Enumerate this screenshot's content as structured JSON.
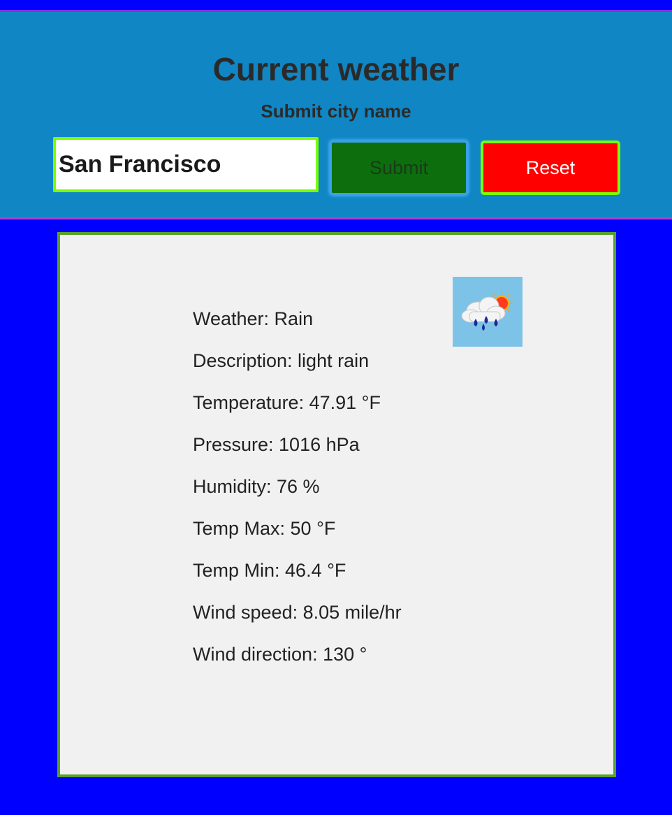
{
  "header": {
    "title": "Current weather",
    "subtitle": "Submit city name",
    "city_input_value": "San Francisco",
    "submit_label": "Submit",
    "reset_label": "Reset"
  },
  "weather": {
    "icon": "rain-cloud-sun-icon",
    "details": [
      "Weather: Rain",
      "Description: light rain",
      "Temperature: 47.91 °F",
      "Pressure: 1016 hPa",
      "Humidity: 76 %",
      "Temp Max: 50 °F",
      "Temp Min: 46.4 °F",
      "Wind speed: 8.05 mile/hr",
      "Wind direction: 130 °"
    ]
  },
  "colors": {
    "page_background": "#0000ff",
    "header_background": "#1186c4",
    "submit_background": "#0d6e0d",
    "reset_background": "#ff0000",
    "accent_border": "#7cfc00"
  }
}
